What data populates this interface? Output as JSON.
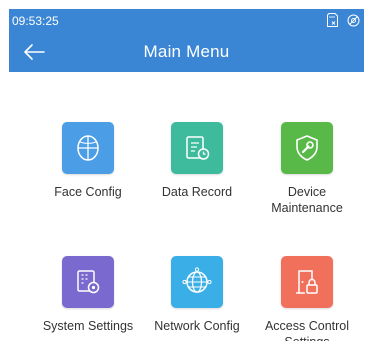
{
  "status_bar": {
    "time": "09:53:25",
    "icons": [
      "sim-card-icon",
      "no-connection-icon"
    ]
  },
  "header": {
    "title": "Main Menu",
    "back_icon": "back-arrow-icon",
    "background": "#3a86d4"
  },
  "menu": {
    "items": [
      {
        "label": "Face Config",
        "icon": "face-icon",
        "color": "#4b9ee6"
      },
      {
        "label": "Data Record",
        "icon": "data-record-icon",
        "color": "#3dbb9c"
      },
      {
        "label": "Device Maintenance",
        "icon": "shield-wrench-icon",
        "color": "#58b848"
      },
      {
        "label": "System Settings",
        "icon": "system-settings-icon",
        "color": "#7a6ad0"
      },
      {
        "label": "Network Config",
        "icon": "network-globe-icon",
        "color": "#3aaee6"
      },
      {
        "label": "Access Control Settings",
        "icon": "door-lock-icon",
        "color": "#f0705c"
      }
    ]
  }
}
